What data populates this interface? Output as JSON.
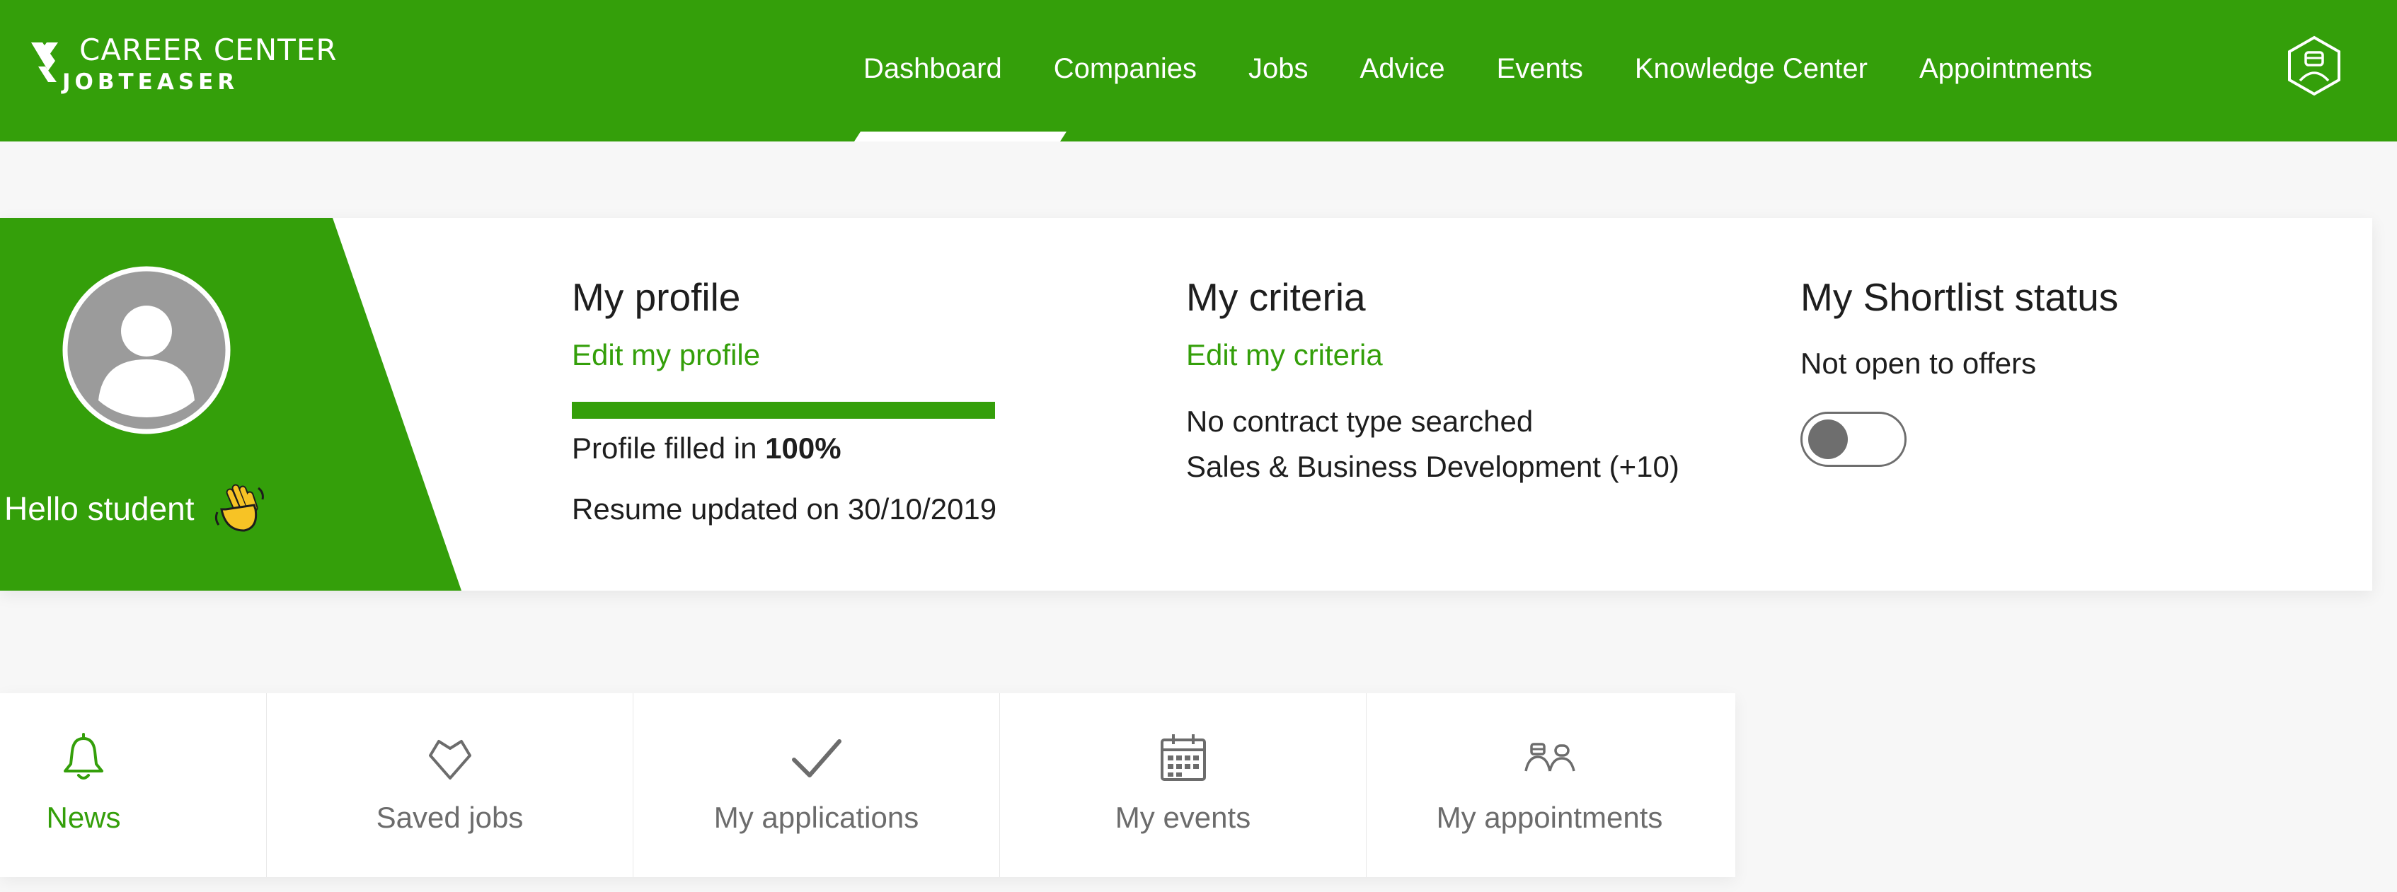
{
  "brand": {
    "line1": "CAREER CENTER",
    "line2": "JOBTEASER",
    "color": "#349f0a"
  },
  "nav": {
    "items": [
      {
        "label": "Dashboard",
        "active": true
      },
      {
        "label": "Companies"
      },
      {
        "label": "Jobs"
      },
      {
        "label": "Advice"
      },
      {
        "label": "Events"
      },
      {
        "label": "Knowledge Center"
      },
      {
        "label": "Appointments"
      }
    ],
    "user_icon": "user-hexagon-icon"
  },
  "greeting": {
    "text": "Hello student",
    "emoji_icon": "waving-hand-icon"
  },
  "profile": {
    "title": "My profile",
    "edit_link": "Edit my profile",
    "progress_percent": 100,
    "filled_prefix": "Profile filled in",
    "filled_value": "100%",
    "resume_updated": "Resume updated on 30/10/2019"
  },
  "criteria": {
    "title": "My criteria",
    "edit_link": "Edit my criteria",
    "contract": "No contract type searched",
    "sector": "Sales & Business Development (+10)"
  },
  "shortlist": {
    "title": "My Shortlist status",
    "status": "Not open to offers",
    "toggle_on": false
  },
  "tabs": [
    {
      "label": "News",
      "icon": "bell-icon",
      "active": true
    },
    {
      "label": "Saved jobs",
      "icon": "heart-icon"
    },
    {
      "label": "My applications",
      "icon": "checkmark-icon"
    },
    {
      "label": "My events",
      "icon": "calendar-icon"
    },
    {
      "label": "My appointments",
      "icon": "people-icon"
    }
  ]
}
